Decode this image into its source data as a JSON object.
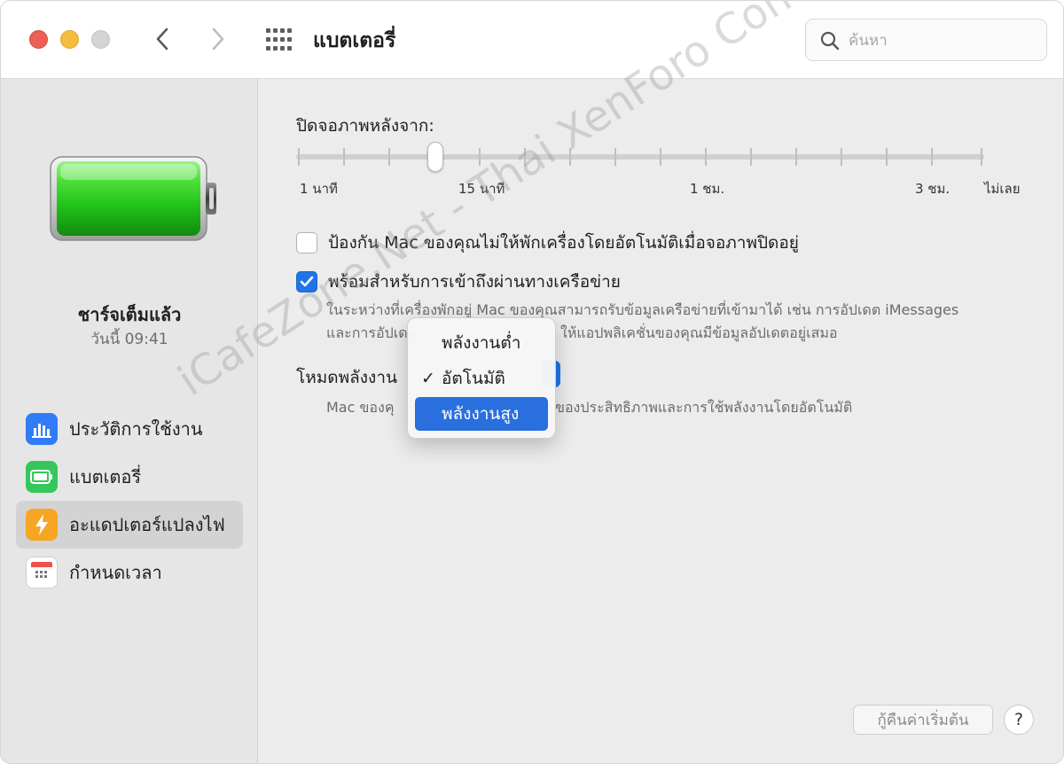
{
  "window": {
    "title": "แบตเตอรี่"
  },
  "search": {
    "placeholder": "ค้นหา"
  },
  "battery_status": {
    "title": "ชาร์จเต็มแล้ว",
    "time": "วันนี้ 09:41",
    "level": 1.0
  },
  "sidebar": {
    "items": [
      {
        "label": "ประวัติการใช้งาน",
        "icon": "bar-chart-icon",
        "color": "#2f7cf6"
      },
      {
        "label": "แบตเตอรี่",
        "icon": "battery-icon",
        "color": "#35c759"
      },
      {
        "label": "อะแดปเตอร์แปลงไฟ",
        "icon": "lightning-icon",
        "color": "#f6a623",
        "selected": true
      },
      {
        "label": "กำหนดเวลา",
        "icon": "calendar-icon",
        "color": "#ffffff"
      }
    ]
  },
  "display_off": {
    "label": "ปิดจอภาพหลังจาก:",
    "ticks": [
      "1 นาที",
      "15 นาที",
      "1 ชม.",
      "3 ชม.",
      "ไม่เลย"
    ],
    "selected": "15 นาที"
  },
  "options": {
    "prevent_sleep": {
      "label": "ป้องกัน Mac ของคุณไม่ให้พักเครื่องโดยอัตโนมัติเมื่อจอภาพปิดอยู่",
      "checked": false
    },
    "network_access": {
      "label": "พร้อมสำหรับการเข้าถึงผ่านทางเครือข่าย",
      "checked": true,
      "desc_line1": "ในระหว่างที่เครื่องพักอยู่ Mac ของคุณสามารถรับข้อมูลเครือข่ายที่เข้ามาได้ เช่น การอัปเดต iMessages",
      "desc_line2_left": "และการอัปเดต",
      "desc_line2_right": "ให้แอปพลิเคชั่นของคุณมีข้อมูลอัปเดตอยู่เสมอ"
    }
  },
  "power_mode": {
    "label": "โหมดพลังงาน",
    "desc_left": "Mac ของคุ",
    "desc_right": "ของประสิทธิภาพและการใช้พลังงานโดยอัตโนมัติ",
    "menu": [
      {
        "label": "พลังงานต่ำ",
        "checked": false,
        "highlighted": false
      },
      {
        "label": "อัตโนมัติ",
        "checked": true,
        "highlighted": false
      },
      {
        "label": "พลังงานสูง",
        "checked": false,
        "highlighted": true
      }
    ],
    "check_glyph": "✓"
  },
  "footer": {
    "reset_label": "กู้คืนค่าเริ่มต้น",
    "help_label": "?"
  },
  "watermark": {
    "text": "iCafeZone.Net - Thai XenForo Community"
  },
  "colors": {
    "accent": "#2174e8",
    "battery_green": "#35c759"
  }
}
